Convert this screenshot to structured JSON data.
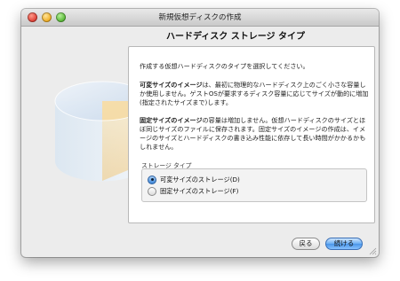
{
  "window": {
    "title": "新規仮想ディスクの作成"
  },
  "header": {
    "title": "ハードディスク ストレージ タイプ"
  },
  "content": {
    "intro": "作成する仮想ハードディスクのタイプを選択してください。",
    "dynamic_bold": "可変サイズのイメージ",
    "dynamic_text": "は、最初に物理的なハードディスク上のごく小さな容量しか使用しません。ゲストOSが要求するディスク容量に応じてサイズが動的に増加(指定されたサイズまで)します。",
    "fixed_bold": "固定サイズのイメージ",
    "fixed_text": "の容量は増加しません。仮想ハードディスクのサイズとほぼ同じサイズのファイルに保存されます。固定サイズのイメージの作成は、イメージのサイズとハードディスクの書き込み性能に依存して長い時間がかかるかもしれません。"
  },
  "storage_type": {
    "label": "ストレージ タイプ",
    "options": [
      {
        "label": "可変サイズのストレージ(D)",
        "selected": true
      },
      {
        "label": "固定サイズのストレージ(F)",
        "selected": false
      }
    ]
  },
  "buttons": {
    "back": "戻る",
    "continue": "続ける"
  }
}
